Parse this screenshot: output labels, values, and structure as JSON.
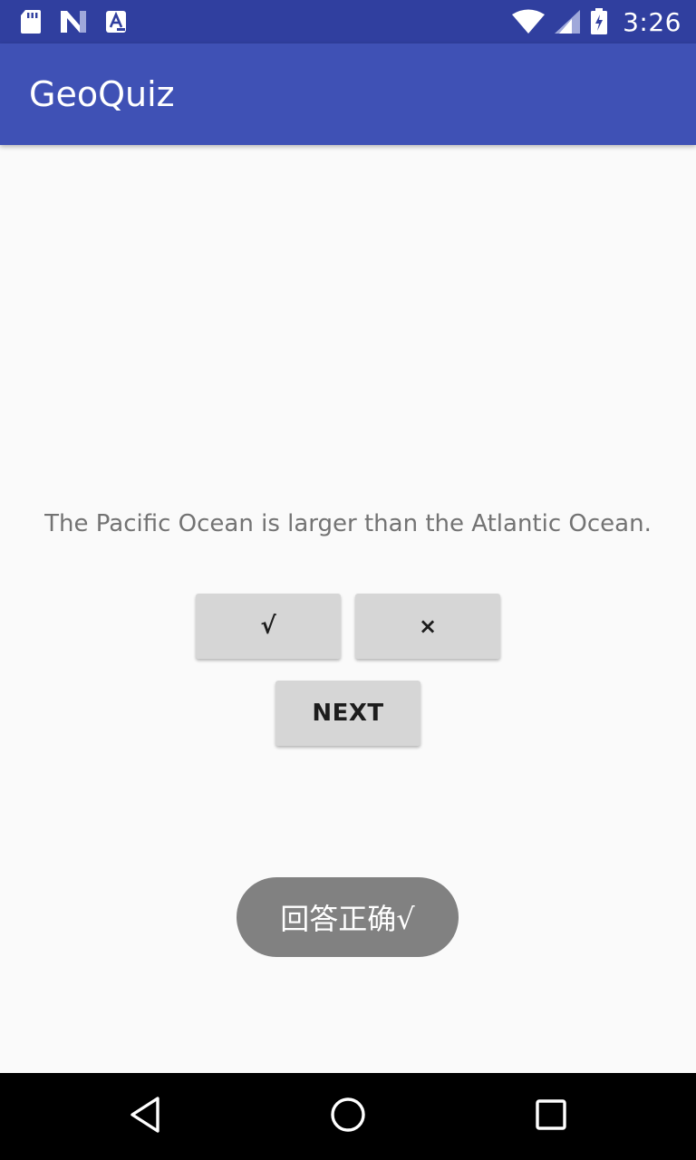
{
  "status_bar": {
    "time": "3:26",
    "left_icons": [
      "sd-card-icon",
      "n-notification-icon",
      "a-notification-icon"
    ],
    "right_icons": [
      "wifi-icon",
      "cell-signal-icon",
      "battery-charging-icon"
    ]
  },
  "app_bar": {
    "title": "GeoQuiz"
  },
  "quiz": {
    "question": "The Pacific Ocean is larger than the Atlantic Ocean.",
    "true_label": "√",
    "false_label": "×",
    "next_label": "NEXT"
  },
  "toast": {
    "message": "回答正确√"
  },
  "nav_bar": {
    "icons": [
      "back-icon",
      "home-icon",
      "recents-icon"
    ]
  },
  "colors": {
    "status_bar": "#303f9f",
    "app_bar": "#3f51b5",
    "background": "#fafafa",
    "button": "#d6d6d6",
    "toast": "#818181"
  }
}
